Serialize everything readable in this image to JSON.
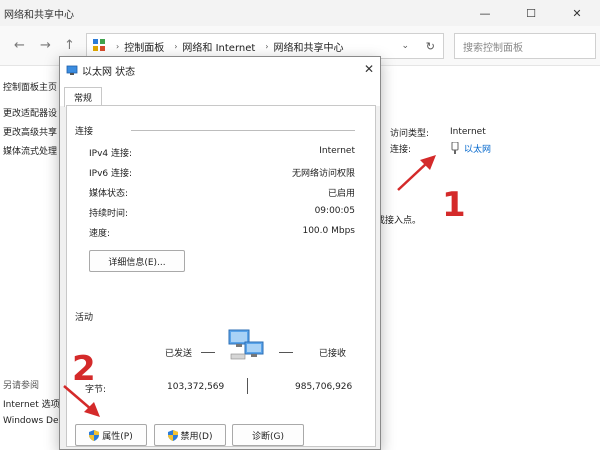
{
  "window": {
    "title": "网络和共享中心",
    "min_glyph": "—",
    "max_glyph": "☐",
    "close_glyph": "✕"
  },
  "addressbar": {
    "crumbs": [
      "控制面板",
      "网络和 Internet",
      "网络和共享中心"
    ],
    "search_placeholder": "搜索控制面板"
  },
  "left_pane": {
    "items": [
      "控制面板主页",
      "更改适配器设",
      "更改高级共享",
      "媒体流式处理"
    ],
    "see_also_header": "另请参阅",
    "see_also": [
      "Internet 选项",
      "Windows De"
    ]
  },
  "right_info": {
    "access_type_label": "访问类型:",
    "access_type_value": "Internet",
    "connection_label": "连接:",
    "connection_value": "以太网",
    "fragment": "或接入点。"
  },
  "dialog": {
    "title": "以太网 状态",
    "close_glyph": "✕",
    "tab": "常规",
    "connection_group": "连接",
    "rows": [
      {
        "k": "IPv4 连接:",
        "v": "Internet"
      },
      {
        "k": "IPv6 连接:",
        "v": "无网络访问权限"
      },
      {
        "k": "媒体状态:",
        "v": "已启用"
      },
      {
        "k": "持续时间:",
        "v": "09:00:05"
      },
      {
        "k": "速度:",
        "v": "100.0 Mbps"
      }
    ],
    "details_button": "详细信息(E)...",
    "activity_group": "活动",
    "sent_label": "已发送",
    "received_label": "已接收",
    "bytes_label": "字节:",
    "bytes_sent": "103,372,569",
    "bytes_received": "985,706,926",
    "properties_button": "属性(P)",
    "disable_button": "禁用(D)",
    "diagnose_button": "诊断(G)"
  },
  "annotations": {
    "one": "1",
    "two": "2",
    "color": "#d42a2a"
  }
}
